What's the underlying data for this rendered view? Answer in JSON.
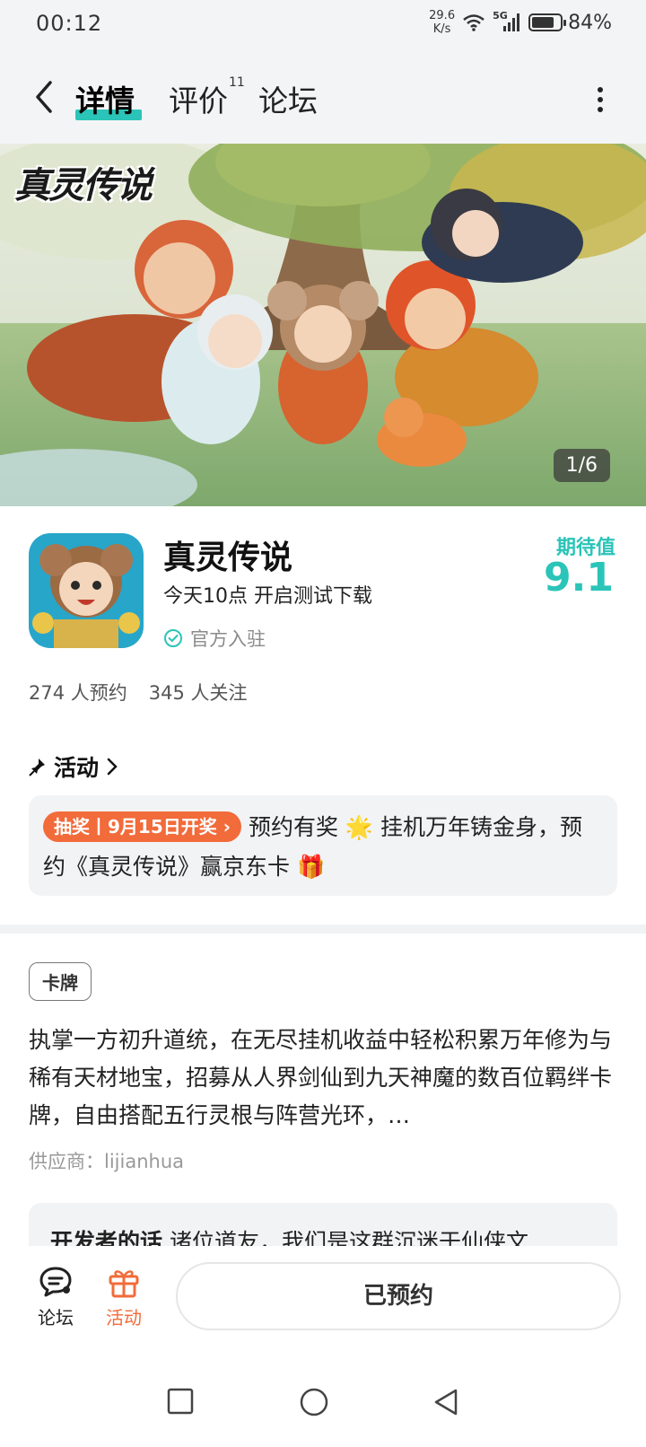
{
  "status_bar": {
    "time": "00:12",
    "net_speed_value": "29.6",
    "net_speed_unit": "K/s",
    "network": "5G",
    "battery": "84%",
    "battery_level": 0.84
  },
  "nav": {
    "tabs": [
      {
        "label": "详情",
        "active": true
      },
      {
        "label": "评价",
        "badge": "11"
      },
      {
        "label": "论坛"
      }
    ]
  },
  "banner": {
    "logo_text": "真灵传说",
    "counter": "1/6"
  },
  "app": {
    "name": "真灵传说",
    "status": "今天10点 开启测试下载",
    "official": "官方入驻",
    "expect_label": "期待值",
    "expect_value": "9.1",
    "reservations": "274 人预约",
    "followers": "345 人关注"
  },
  "activity": {
    "title": "活动",
    "pill": "抽奖丨9月15日开奖 ›",
    "text_a": "预约有奖 🌟 挂机万年铸金身，预约《真灵传说》赢京东卡 🎁"
  },
  "description": {
    "tag": "卡牌",
    "text": "执掌一方初升道统，在无尽挂机收益中轻松积累万年修为与稀有天材地宝，招募从人界剑仙到九天神魔的数百位羁绊卡牌，自由搭配五行灵根与阵营光环，…",
    "supplier": "供应商：lijianhua"
  },
  "developer": {
    "label": "开发者的话",
    "text": "诸位道友，我们是这群沉迷于仙侠文"
  },
  "bottom_bar": {
    "forum_label": "论坛",
    "activity_label": "活动",
    "reserved_label": "已预约"
  },
  "colors": {
    "accent": "#2bc4b8",
    "orange": "#f26b3a"
  }
}
